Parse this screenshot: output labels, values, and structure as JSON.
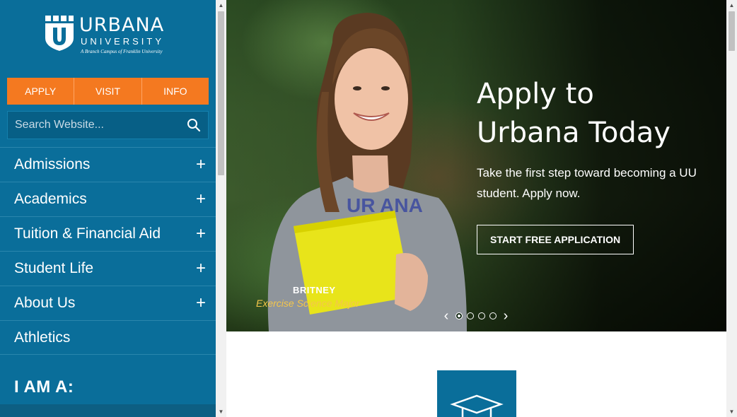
{
  "logo": {
    "wordmark": "URBANA",
    "wordmark2": "UNIVERSITY",
    "tagline": "A Branch Campus of Franklin University"
  },
  "cta": {
    "apply": "APPLY",
    "visit": "VISIT",
    "info": "INFO"
  },
  "search": {
    "placeholder": "Search Website..."
  },
  "nav": {
    "items": [
      {
        "label": "Admissions",
        "expand": "+"
      },
      {
        "label": "Academics",
        "expand": "+"
      },
      {
        "label": "Tuition & Financial Aid",
        "expand": "+"
      },
      {
        "label": "Student Life",
        "expand": "+"
      },
      {
        "label": "About Us",
        "expand": "+"
      },
      {
        "label": "Athletics"
      }
    ]
  },
  "iam": {
    "title": "I AM A:"
  },
  "hero": {
    "title_line1": "Apply to",
    "title_line2": "Urbana Today",
    "subtitle": "Take the first step toward becoming a UU student. Apply now.",
    "button": "START FREE APPLICATION",
    "student_name": "BRITNEY",
    "student_major": "Exercise Science Major",
    "slides": 4,
    "active_slide": 1
  },
  "colors": {
    "sidebar": "#0a6e9a",
    "accent": "#f47920",
    "major_text": "#f5c64a"
  }
}
